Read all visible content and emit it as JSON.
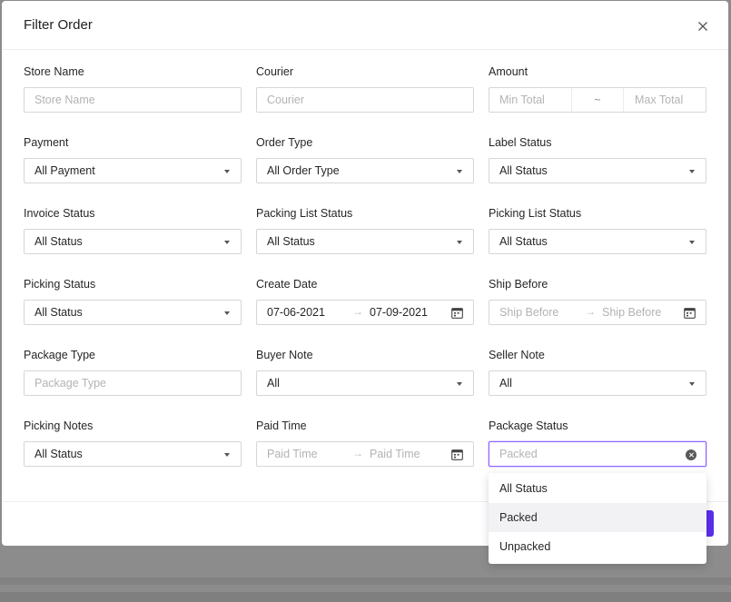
{
  "modal": {
    "title": "Filter Order"
  },
  "fields": {
    "store_name": {
      "label": "Store Name",
      "placeholder": "Store Name"
    },
    "courier": {
      "label": "Courier",
      "placeholder": "Courier"
    },
    "amount": {
      "label": "Amount",
      "min_placeholder": "Min Total",
      "separator": "~",
      "max_placeholder": "Max Total"
    },
    "payment": {
      "label": "Payment",
      "value": "All Payment"
    },
    "order_type": {
      "label": "Order Type",
      "value": "All Order Type"
    },
    "label_status": {
      "label": "Label Status",
      "value": "All Status"
    },
    "invoice_status": {
      "label": "Invoice Status",
      "value": "All Status"
    },
    "packing_list_status": {
      "label": "Packing List Status",
      "value": "All Status"
    },
    "picking_list_status": {
      "label": "Picking List Status",
      "value": "All Status"
    },
    "picking_status": {
      "label": "Picking Status",
      "value": "All Status"
    },
    "create_date": {
      "label": "Create Date",
      "start": "07-06-2021",
      "end": "07-09-2021",
      "separator": "→"
    },
    "ship_before": {
      "label": "Ship Before",
      "start_placeholder": "Ship Before",
      "end_placeholder": "Ship Before",
      "separator": "→"
    },
    "package_type": {
      "label": "Package Type",
      "placeholder": "Package Type"
    },
    "buyer_note": {
      "label": "Buyer Note",
      "value": "All"
    },
    "seller_note": {
      "label": "Seller Note",
      "value": "All"
    },
    "picking_notes": {
      "label": "Picking Notes",
      "value": "All Status"
    },
    "paid_time": {
      "label": "Paid Time",
      "start_placeholder": "Paid Time",
      "end_placeholder": "Paid Time",
      "separator": "→"
    },
    "package_status": {
      "label": "Package Status",
      "placeholder": "Packed"
    }
  },
  "dropdown": {
    "options": [
      "All Status",
      "Packed",
      "Unpacked"
    ],
    "highlighted": "Packed"
  },
  "colors": {
    "accent": "#8d62ff",
    "primary_button": "#5b2eef"
  },
  "icons": {
    "close": "close-icon",
    "calendar": "calendar-icon",
    "clear": "clear-icon",
    "caret": "caret-down-icon"
  }
}
